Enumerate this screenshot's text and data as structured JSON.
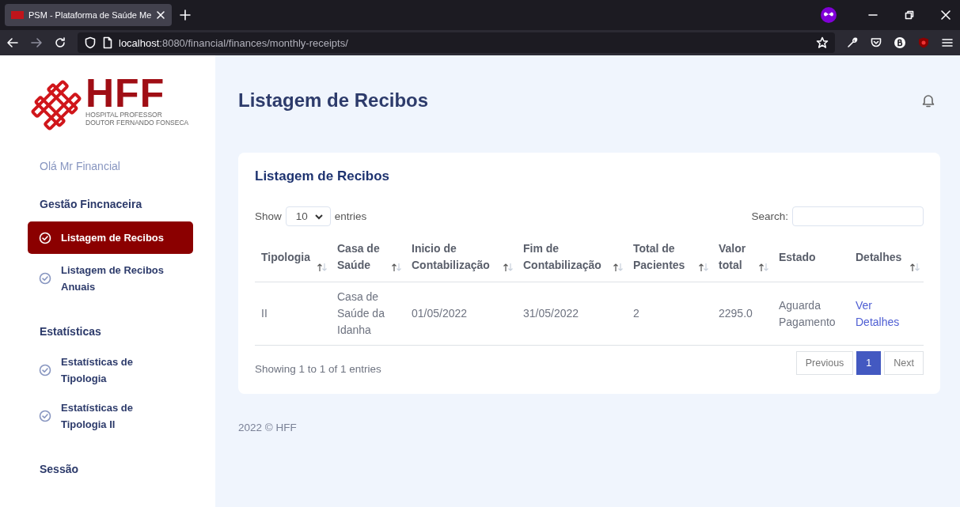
{
  "browser": {
    "tab_title": "PSM - Plataforma de Saúde Me",
    "url_host": "localhost",
    "url_path": ":8080/financial/finances/monthly-receipts/"
  },
  "sidebar": {
    "logo": {
      "mark": "HFF",
      "line1": "HOSPITAL PROFESSOR",
      "line2": "DOUTOR FERNANDO FONSECA"
    },
    "greeting": "Olá Mr Financial",
    "sections": [
      {
        "title": "Gestão Fincnaceira",
        "items": [
          {
            "label": "Listagem de Recibos",
            "selected": true
          },
          {
            "label": "Listagem de Recibos Anuais",
            "selected": false
          }
        ]
      },
      {
        "title": "Estatísticas",
        "items": [
          {
            "label": "Estatísticas de Tipologia",
            "selected": false
          },
          {
            "label": "Estatísticas de Tipologia II",
            "selected": false
          }
        ]
      },
      {
        "title": "Sessão"
      }
    ]
  },
  "header": {
    "title": "Listagem de Recibos"
  },
  "card": {
    "title": "Listagem de Recibos",
    "length": {
      "before": "Show",
      "value": "10",
      "after": "entries"
    },
    "search": {
      "label": "Search:"
    },
    "table": {
      "columns": [
        {
          "label": "Tipologia",
          "sortable": true
        },
        {
          "label": "Casa de Saúde",
          "sortable": true
        },
        {
          "label": "Inicio de Contabilização",
          "sortable": true
        },
        {
          "label": "Fim de Contabilização",
          "sortable": true
        },
        {
          "label": "Total de Pacientes",
          "sortable": true
        },
        {
          "label": "Valor total",
          "sortable": true
        },
        {
          "label": "Estado",
          "sortable": false
        },
        {
          "label": "Detalhes",
          "sortable": true
        }
      ],
      "rows": [
        {
          "cells": [
            {
              "kind": "text",
              "text": "II"
            },
            {
              "kind": "text",
              "text": "Casa de Saúde da Idanha"
            },
            {
              "kind": "text",
              "text": "01/05/2022"
            },
            {
              "kind": "text",
              "text": "31/05/2022"
            },
            {
              "kind": "text",
              "text": "2"
            },
            {
              "kind": "text",
              "text": "2295.0"
            },
            {
              "kind": "text",
              "text": "Aguarda Pagamento"
            },
            {
              "kind": "link",
              "text": "Ver Detalhes"
            }
          ]
        }
      ]
    },
    "info": "Showing 1 to 1 of 1 entries",
    "pagination": [
      {
        "label": "Previous",
        "selected": false
      },
      {
        "label": "1",
        "selected": true
      },
      {
        "label": "Next",
        "selected": false
      }
    ]
  },
  "footer": "2022 © HFF"
}
